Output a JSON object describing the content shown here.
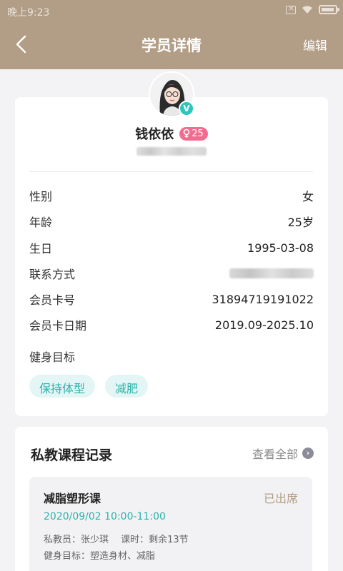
{
  "status_bar": {
    "time": "晚上9:23"
  },
  "nav": {
    "title": "学员详情",
    "edit_label": "编辑"
  },
  "profile": {
    "name": "钱依依",
    "age_badge": "25",
    "verified_mark": "V"
  },
  "info": [
    {
      "label": "性别",
      "value": "女"
    },
    {
      "label": "年龄",
      "value": "25岁"
    },
    {
      "label": "生日",
      "value": "1995-03-08"
    },
    {
      "label": "联系方式",
      "value": ""
    },
    {
      "label": "会员卡号",
      "value": "31894719191022"
    },
    {
      "label": "会员卡日期",
      "value": "2019.09-2025.10"
    }
  ],
  "goals": {
    "label": "健身目标",
    "tags": [
      "保持体型",
      "减肥"
    ]
  },
  "courses": {
    "title": "私教课程记录",
    "view_all_label": "查看全部",
    "records": [
      {
        "name": "减脂塑形课",
        "status": "已出席",
        "time": "2020/09/02 10:00-11:00",
        "coach_line": "私教员：张少琪　 课时：剩余13节",
        "goal_line": "健身目标：塑造身材、减脂"
      }
    ]
  },
  "colors": {
    "header": "#b29d86",
    "accent": "#2bb3ab",
    "badge_pink": "#f36c8f"
  }
}
